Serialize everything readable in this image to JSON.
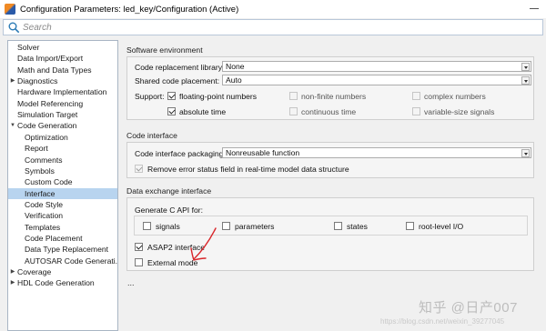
{
  "window": {
    "title": "Configuration Parameters: led_key/Configuration (Active)",
    "icon": "simulink-app-icon"
  },
  "search": {
    "placeholder": "Search",
    "icon": "search-icon"
  },
  "tree": {
    "items": [
      {
        "label": "Solver",
        "level": 0,
        "expander": ""
      },
      {
        "label": "Data Import/Export",
        "level": 0,
        "expander": ""
      },
      {
        "label": "Math and Data Types",
        "level": 0,
        "expander": ""
      },
      {
        "label": "Diagnostics",
        "level": 0,
        "expander": "collapsed"
      },
      {
        "label": "Hardware Implementation",
        "level": 0,
        "expander": ""
      },
      {
        "label": "Model Referencing",
        "level": 0,
        "expander": ""
      },
      {
        "label": "Simulation Target",
        "level": 0,
        "expander": ""
      },
      {
        "label": "Code Generation",
        "level": 0,
        "expander": "expanded"
      },
      {
        "label": "Optimization",
        "level": 1,
        "expander": ""
      },
      {
        "label": "Report",
        "level": 1,
        "expander": ""
      },
      {
        "label": "Comments",
        "level": 1,
        "expander": ""
      },
      {
        "label": "Symbols",
        "level": 1,
        "expander": ""
      },
      {
        "label": "Custom Code",
        "level": 1,
        "expander": ""
      },
      {
        "label": "Interface",
        "level": 1,
        "expander": "",
        "selected": true
      },
      {
        "label": "Code Style",
        "level": 1,
        "expander": ""
      },
      {
        "label": "Verification",
        "level": 1,
        "expander": ""
      },
      {
        "label": "Templates",
        "level": 1,
        "expander": ""
      },
      {
        "label": "Code Placement",
        "level": 1,
        "expander": ""
      },
      {
        "label": "Data Type Replacement",
        "level": 1,
        "expander": ""
      },
      {
        "label": "AUTOSAR Code Generati...",
        "level": 1,
        "expander": ""
      },
      {
        "label": "Coverage",
        "level": 0,
        "expander": "collapsed"
      },
      {
        "label": "HDL Code Generation",
        "level": 0,
        "expander": "collapsed"
      }
    ]
  },
  "software_environment": {
    "title": "Software environment",
    "code_replacement_label": "Code replacement library:",
    "code_replacement_value": "None",
    "shared_code_label": "Shared code placement:",
    "shared_code_value": "Auto",
    "support_label": "Support:",
    "support_options": [
      {
        "label": "floating-point numbers",
        "checked": true,
        "enabled": true
      },
      {
        "label": "non-finite numbers",
        "checked": false,
        "enabled": false
      },
      {
        "label": "complex numbers",
        "checked": false,
        "enabled": false
      },
      {
        "label": "absolute time",
        "checked": true,
        "enabled": true
      },
      {
        "label": "continuous time",
        "checked": false,
        "enabled": false
      },
      {
        "label": "variable-size signals",
        "checked": false,
        "enabled": false
      }
    ]
  },
  "code_interface": {
    "title": "Code interface",
    "packaging_label": "Code interface packaging:",
    "packaging_value": "Nonreusable function",
    "remove_error_label": "Remove error status field in real-time model data structure",
    "remove_error_checked": true
  },
  "data_exchange": {
    "title": "Data exchange interface",
    "generate_c_api_label": "Generate C API for:",
    "c_api_options": [
      {
        "label": "signals",
        "checked": false
      },
      {
        "label": "parameters",
        "checked": false
      },
      {
        "label": "states",
        "checked": false
      },
      {
        "label": "root-level I/O",
        "checked": false
      }
    ],
    "asap2_label": "ASAP2 interface",
    "asap2_checked": true,
    "external_mode_label": "External mode",
    "external_mode_checked": false
  },
  "ellipsis": "...",
  "watermark": {
    "main": "知乎 @日产007",
    "url": "https://blog.csdn.net/weixin_39277045"
  },
  "colors": {
    "selection": "#b8d4ef",
    "annotation_arrow": "#d9262b",
    "panel_bg": "#f0f0f0"
  }
}
